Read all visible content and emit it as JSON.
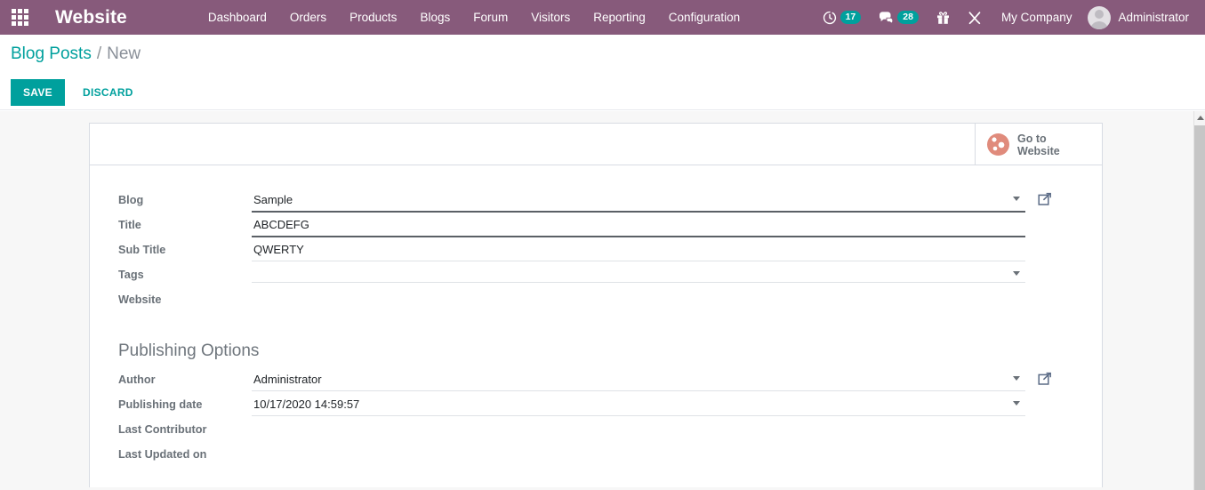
{
  "navbar": {
    "apps_icon": "apps-grid-icon",
    "brand": "Website",
    "menu": [
      {
        "label": "Dashboard"
      },
      {
        "label": "Orders"
      },
      {
        "label": "Products"
      },
      {
        "label": "Blogs"
      },
      {
        "label": "Forum"
      },
      {
        "label": "Visitors"
      },
      {
        "label": "Reporting"
      },
      {
        "label": "Configuration"
      }
    ],
    "systray": {
      "activity_icon": "clock-activity-icon",
      "activity_count": "17",
      "messaging_icon": "chat-bubble-icon",
      "messaging_count": "28",
      "gift_icon": "gift-icon",
      "tools_icon": "crossed-tools-icon",
      "company": "My Company",
      "avatar_icon": "user-avatar-icon",
      "user": "Administrator"
    },
    "accent_color": "#875A7B",
    "badge_color": "#00A09D"
  },
  "control_panel": {
    "breadcrumb": {
      "root": "Blog Posts",
      "separator": "/",
      "current": "New"
    },
    "save_label": "SAVE",
    "discard_label": "DISCARD",
    "save_color": "#00A09D"
  },
  "sheet": {
    "button_box": {
      "icon": "globe-icon",
      "label": "Go to Website"
    },
    "fields": [
      {
        "label": "Blog",
        "value": "Sample",
        "underline": "strong",
        "caret": true,
        "ext_link": true
      },
      {
        "label": "Title",
        "value": "ABCDEFG",
        "underline": "strong",
        "caret": false,
        "ext_link": false
      },
      {
        "label": "Sub Title",
        "value": "QWERTY",
        "underline": "light",
        "caret": false,
        "ext_link": false
      },
      {
        "label": "Tags",
        "value": "",
        "underline": "light",
        "caret": true,
        "ext_link": false
      },
      {
        "label": "Website",
        "value": "",
        "underline": "none",
        "caret": false,
        "ext_link": false
      }
    ],
    "publishing_options": {
      "title": "Publishing Options",
      "fields": [
        {
          "label": "Author",
          "value": "Administrator",
          "underline": "light",
          "caret": true,
          "ext_link": true
        },
        {
          "label": "Publishing date",
          "value": "10/17/2020 14:59:57",
          "underline": "light",
          "caret": true,
          "ext_link": false
        },
        {
          "label": "Last Contributor",
          "value": "",
          "underline": "none",
          "caret": false,
          "ext_link": false
        },
        {
          "label": "Last Updated on",
          "value": "",
          "underline": "none",
          "caret": false,
          "ext_link": false
        }
      ]
    }
  },
  "scrollbar": {
    "up_arrow_icon": "chevron-up-icon"
  }
}
